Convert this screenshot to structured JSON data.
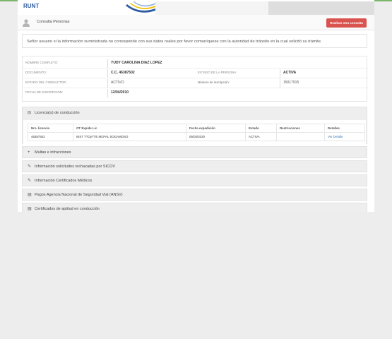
{
  "brand": {
    "name": "RUNT"
  },
  "subbar": {
    "title": "Consulta Personas",
    "button": "Realizar otra consulta"
  },
  "notice": "Señor usuario si la información suministrada no corresponde con sus datos reales por favor comuníquese con la autoridad de tránsito en la cual solicitó su trámite.",
  "person": {
    "name_label": "NOMBRE COMPLETO:",
    "name": "YUDY CAROLINA DIAZ LOPEZ",
    "doc_label": "DOCUMENTO:",
    "doc": "C.C. 46387502",
    "estado_persona_label": "ESTADO DE LA PERSONA:",
    "estado_persona": "ACTIVA",
    "estado_conductor_label": "ESTADO DEL CONDUCTOR:",
    "estado_conductor": "ACTIVO",
    "inscripcion_label": "Número de inscripción:",
    "inscripcion": "15017915",
    "fecha_label": "FECHA DE INSCRIPCIÓN:",
    "fecha": "12/04/2010"
  },
  "licencias": {
    "title": "Licencia(s) de conducción",
    "headers": [
      "Nro. licencia",
      "OT Expide Lic",
      "Fecha expedición",
      "Estado",
      "Restricciones",
      "Detalles"
    ],
    "rows": [
      {
        "nro": "46387502",
        "ot": "INST TTOyTTE MCPAL SOGAMOSO",
        "fecha": "05/03/2020",
        "estado": "ACTIVA",
        "restricciones": "",
        "detalles": "Ver Detalle"
      }
    ]
  },
  "sections": [
    {
      "title": "Multas e infracciones"
    },
    {
      "title": "Información solicitudes rechazadas por SICOV"
    },
    {
      "title": "Información Certificados Médicos"
    },
    {
      "title": "Pagos Agencia Nacional de Seguridad Vial (ANSV)"
    },
    {
      "title": "Certificados de aptitud en conducción"
    }
  ],
  "icons": {
    "user": "user-icon",
    "minus": "minus-icon",
    "plus": "plus-icon",
    "check": "check-icon",
    "card": "card-icon"
  },
  "colors": {
    "brand_blue": "#2d5aa0",
    "button_red": "#d9534f",
    "link_blue": "#337ab7",
    "top_green": "#7cb66a"
  }
}
